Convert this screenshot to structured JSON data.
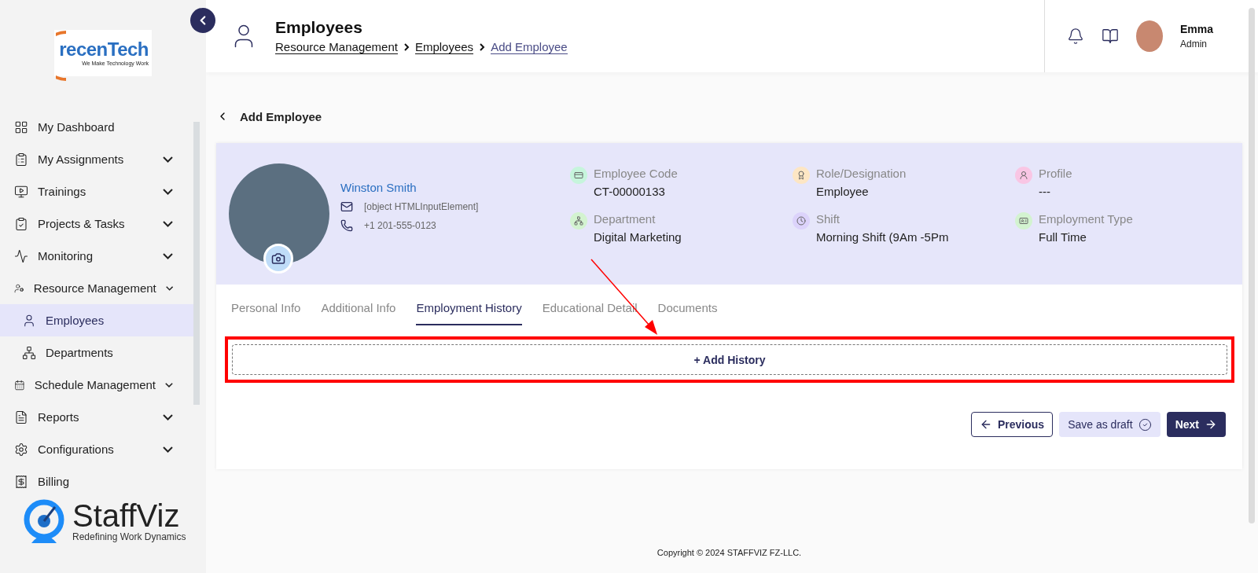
{
  "brand": {
    "name": "recenTech",
    "tagline": "We Make Technology Work"
  },
  "sidebar": {
    "items": [
      {
        "label": "My Dashboard",
        "expandable": false,
        "selected": false
      },
      {
        "label": "My Assignments",
        "expandable": true,
        "selected": false
      },
      {
        "label": "Trainings",
        "expandable": true,
        "selected": false
      },
      {
        "label": "Projects & Tasks",
        "expandable": true,
        "selected": false
      },
      {
        "label": "Monitoring",
        "expandable": true,
        "selected": false
      },
      {
        "label": "Resource Management",
        "expandable": true,
        "selected": false,
        "children": [
          {
            "label": "Employees",
            "selected": true
          },
          {
            "label": "Departments",
            "selected": false
          }
        ]
      },
      {
        "label": "Schedule Management",
        "expandable": true,
        "selected": false
      },
      {
        "label": "Reports",
        "expandable": true,
        "selected": false
      },
      {
        "label": "Configurations",
        "expandable": true,
        "selected": false
      },
      {
        "label": "Billing",
        "expandable": false,
        "selected": false
      }
    ]
  },
  "footer_brand": {
    "name": "StaffViz",
    "tagline": "Redefining Work Dynamics"
  },
  "header": {
    "title": "Employees",
    "breadcrumbs": [
      "Resource Management",
      "Employees",
      "Add Employee"
    ],
    "user": {
      "name": "Emma",
      "role": "Admin"
    }
  },
  "page": {
    "back_label": "Add Employee"
  },
  "profile": {
    "name": "Winston Smith",
    "email": "[object HTMLInputElement]",
    "phone": "+1 201-555-0123",
    "fields": [
      {
        "label": "Employee Code",
        "value": "CT-00000133",
        "color": "#c6f5dc"
      },
      {
        "label": "Role/Designation",
        "value": "Employee",
        "color": "#fde6c4"
      },
      {
        "label": "Profile",
        "value": "---",
        "color": "#f9c6e4"
      },
      {
        "label": "Department",
        "value": "Digital Marketing",
        "color": "#d3f3d0"
      },
      {
        "label": "Shift",
        "value": "Morning Shift (9Am -5Pm",
        "color": "#dcd3fb"
      },
      {
        "label": "Employment Type",
        "value": "Full Time",
        "color": "#d3f3d0"
      }
    ]
  },
  "tabs": [
    {
      "label": "Personal Info",
      "selected": false
    },
    {
      "label": "Additional Info",
      "selected": false
    },
    {
      "label": "Employment History",
      "selected": true
    },
    {
      "label": "Educational Detail",
      "selected": false
    },
    {
      "label": "Documents",
      "selected": false
    }
  ],
  "add_history": {
    "label": "+ Add History"
  },
  "buttons": [
    {
      "label": "Previous",
      "kind": "previous"
    },
    {
      "label": "Save as draft",
      "kind": "draft"
    },
    {
      "label": "Next",
      "kind": "next"
    }
  ],
  "copyright": "Copyright © 2024 STAFFVIZ FZ-LLC."
}
